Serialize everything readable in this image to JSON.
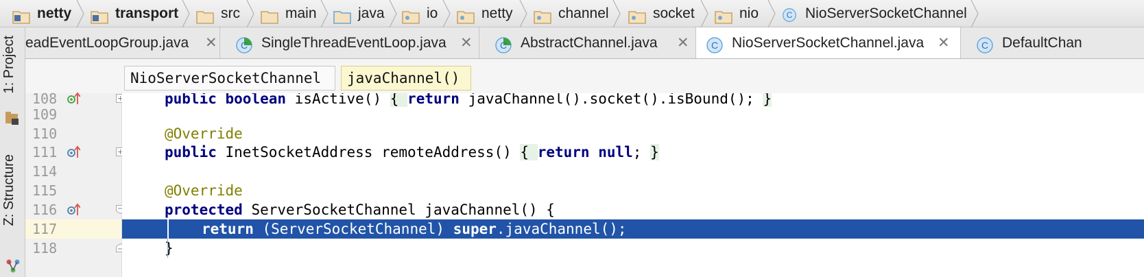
{
  "navbar": {
    "crumbs": [
      {
        "label": "netty",
        "icon": "module-folder-icon",
        "bold": true
      },
      {
        "label": "transport",
        "icon": "module-folder-icon",
        "bold": true
      },
      {
        "label": "src",
        "icon": "folder-icon",
        "bold": false
      },
      {
        "label": "main",
        "icon": "folder-icon",
        "bold": false
      },
      {
        "label": "java",
        "icon": "source-folder-icon",
        "bold": false
      },
      {
        "label": "io",
        "icon": "package-icon",
        "bold": false
      },
      {
        "label": "netty",
        "icon": "package-icon",
        "bold": false
      },
      {
        "label": "channel",
        "icon": "package-icon",
        "bold": false
      },
      {
        "label": "socket",
        "icon": "package-icon",
        "bold": false
      },
      {
        "label": "nio",
        "icon": "package-icon",
        "bold": false
      },
      {
        "label": "NioServerSocketChannel",
        "icon": "class-icon",
        "bold": false
      }
    ]
  },
  "leftstrip": {
    "project_label": "1: Project",
    "structure_label": "Z: Structure"
  },
  "tabs": [
    {
      "label": "eadEventLoopGroup.java",
      "close": "✕",
      "icon": "none"
    },
    {
      "label": "SingleThreadEventLoop.java",
      "close": "✕",
      "icon": "abstract-class-icon"
    },
    {
      "label": "AbstractChannel.java",
      "close": "✕",
      "icon": "abstract-class-icon"
    },
    {
      "label": "NioServerSocketChannel.java",
      "close": "✕",
      "icon": "class-icon",
      "active": true
    },
    {
      "label": "DefaultChan",
      "close": "",
      "icon": "class-icon"
    }
  ],
  "chips": {
    "class_chip": "NioServerSocketChannel",
    "method_chip": "javaChannel()"
  },
  "code": {
    "lines": [
      {
        "num": "108",
        "marker": "implements-icon",
        "text_parts": [
          [
            "kw",
            "public "
          ],
          [
            "kw",
            "boolean "
          ],
          [
            "p",
            "isActive() "
          ],
          [
            "fold",
            "{ "
          ],
          [
            "kw",
            "return "
          ],
          [
            "p",
            "javaChannel().socket().isBound(); "
          ],
          [
            "fold",
            "}"
          ]
        ]
      },
      {
        "num": "109",
        "marker": "",
        "text_parts": []
      },
      {
        "num": "110",
        "marker": "",
        "text_parts": [
          [
            "ann",
            "@Override"
          ]
        ]
      },
      {
        "num": "111",
        "marker": "overrides-icon",
        "text_parts": [
          [
            "kw",
            "public "
          ],
          [
            "p",
            "InetSocketAddress remoteAddress() "
          ],
          [
            "fold",
            "{ "
          ],
          [
            "kw",
            "return "
          ],
          [
            "kw",
            "null"
          ],
          [
            "p",
            "; "
          ],
          [
            "fold",
            "}"
          ]
        ]
      },
      {
        "num": "114",
        "marker": "",
        "text_parts": []
      },
      {
        "num": "115",
        "marker": "",
        "text_parts": [
          [
            "ann",
            "@Override"
          ]
        ]
      },
      {
        "num": "116",
        "marker": "overrides-icon",
        "text_parts": [
          [
            "kw",
            "protected "
          ],
          [
            "p",
            "ServerSocketChannel javaChannel() {"
          ]
        ]
      },
      {
        "num": "117",
        "marker": "",
        "text_parts": [
          [
            "kw",
            "return "
          ],
          [
            "p",
            "(ServerSocketChannel) "
          ],
          [
            "kw",
            "super"
          ],
          [
            "p",
            ".javaChannel();"
          ]
        ],
        "selected": true
      },
      {
        "num": "118",
        "marker": "",
        "text_parts": [
          [
            "p",
            "}"
          ]
        ]
      }
    ]
  },
  "colors": {
    "selection": "#2154a8",
    "keyword": "#000080",
    "annotation": "#808000"
  }
}
